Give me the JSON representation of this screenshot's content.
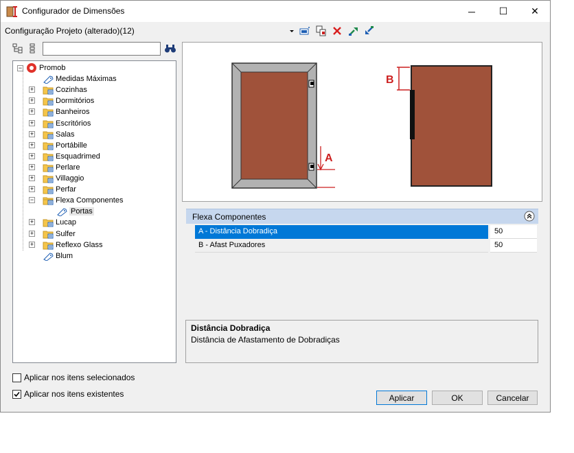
{
  "window": {
    "title": "Configurador de Dimensões",
    "minimize_glyph": "─",
    "maximize_glyph": "☐",
    "close_glyph": "✕"
  },
  "toolbar": {
    "config_label": "Configuração Projeto (alterado)(12)",
    "icons": [
      "dropdown-arrow-icon",
      "apply-config-icon",
      "copy-config-icon",
      "delete-icon",
      "export-icon",
      "import-icon"
    ]
  },
  "search": {
    "value": "",
    "placeholder": ""
  },
  "tree": {
    "root": "Promob",
    "items": [
      {
        "label": "Medidas Máximas",
        "kind": "item"
      },
      {
        "label": "Cozinhas",
        "kind": "folder"
      },
      {
        "label": "Dormitórios",
        "kind": "folder"
      },
      {
        "label": "Banheiros",
        "kind": "folder"
      },
      {
        "label": "Escritórios",
        "kind": "folder"
      },
      {
        "label": "Salas",
        "kind": "folder"
      },
      {
        "label": "Portábille",
        "kind": "folder"
      },
      {
        "label": "Esquadrimed",
        "kind": "folder"
      },
      {
        "label": "Perlare",
        "kind": "folder"
      },
      {
        "label": "Villaggio",
        "kind": "folder"
      },
      {
        "label": "Perfar",
        "kind": "folder"
      },
      {
        "label": "Flexa Componentes",
        "kind": "folder-open"
      },
      {
        "label": "Portas",
        "kind": "item-selected"
      },
      {
        "label": "Lucap",
        "kind": "folder"
      },
      {
        "label": "Sulfer",
        "kind": "folder"
      },
      {
        "label": "Reflexo Glass",
        "kind": "folder"
      },
      {
        "label": "Blum",
        "kind": "item"
      }
    ]
  },
  "preview": {
    "label_a": "A",
    "label_b": "B",
    "door_color": "#a0523a",
    "marker_color": "#cc1f1f"
  },
  "properties": {
    "group_title": "Flexa Componentes",
    "rows": [
      {
        "name": "A - Distância Dobradiça",
        "value": "50"
      },
      {
        "name": "B -  Afast Puxadores",
        "value": "50"
      }
    ]
  },
  "description": {
    "title": "Distância Dobradiça",
    "text": "Distância de Afastamento de  Dobradiças"
  },
  "options": {
    "apply_selected": {
      "label": "Aplicar nos itens selecionados",
      "checked": false
    },
    "apply_existing": {
      "label": "Aplicar nos itens existentes",
      "checked": true
    }
  },
  "buttons": {
    "apply": "Aplicar",
    "ok": "OK",
    "cancel": "Cancelar"
  },
  "colors": {
    "selection": "#0078d7",
    "group_header": "#c6d7ee"
  }
}
